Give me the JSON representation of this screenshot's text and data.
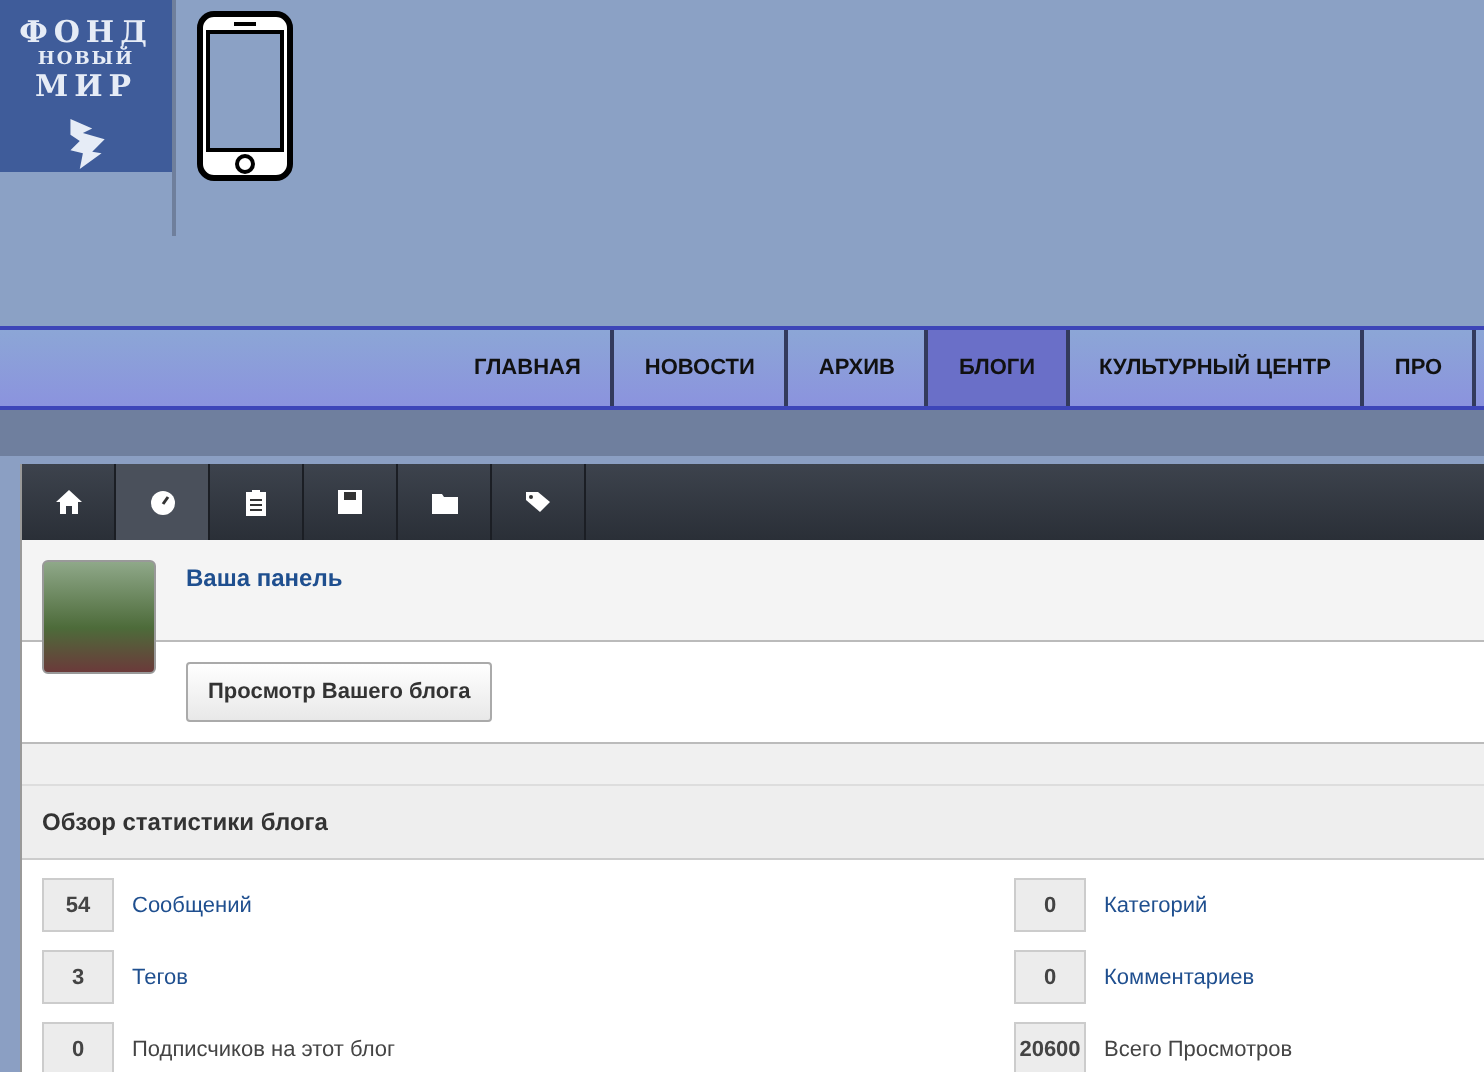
{
  "logo": {
    "lines": [
      "ФОНД",
      "НОВЫЙ",
      "МИР"
    ]
  },
  "nav": [
    {
      "label": "ГЛАВНАЯ",
      "selected": false
    },
    {
      "label": "НОВОСТИ",
      "selected": false
    },
    {
      "label": "АРХИВ",
      "selected": false
    },
    {
      "label": "БЛОГИ",
      "selected": true
    },
    {
      "label": "КУЛЬТУРНЫЙ ЦЕНТР",
      "selected": false
    },
    {
      "label": "ПРО",
      "selected": false
    }
  ],
  "toolbar": [
    {
      "kind": "home",
      "selected": false
    },
    {
      "kind": "dashboard",
      "selected": true
    },
    {
      "kind": "clipboard",
      "selected": false
    },
    {
      "kind": "save",
      "selected": false
    },
    {
      "kind": "folder",
      "selected": false
    },
    {
      "kind": "tag",
      "selected": false
    }
  ],
  "profile": {
    "title": "Ваша панель",
    "button": "Просмотр Вашего блога"
  },
  "stats": {
    "title": "Обзор статистики блога",
    "items": [
      {
        "count": "54",
        "label": "Сообщений",
        "kind": "link"
      },
      {
        "count": "0",
        "label": "Категорий",
        "kind": "link"
      },
      {
        "count": "3",
        "label": "Тегов",
        "kind": "link"
      },
      {
        "count": "0",
        "label": "Комментариев",
        "kind": "link"
      },
      {
        "count": "0",
        "label": "Подписчиков на этот блог",
        "kind": "plain"
      },
      {
        "count": "20600",
        "label": "Всего Просмотров",
        "kind": "plain"
      }
    ]
  }
}
